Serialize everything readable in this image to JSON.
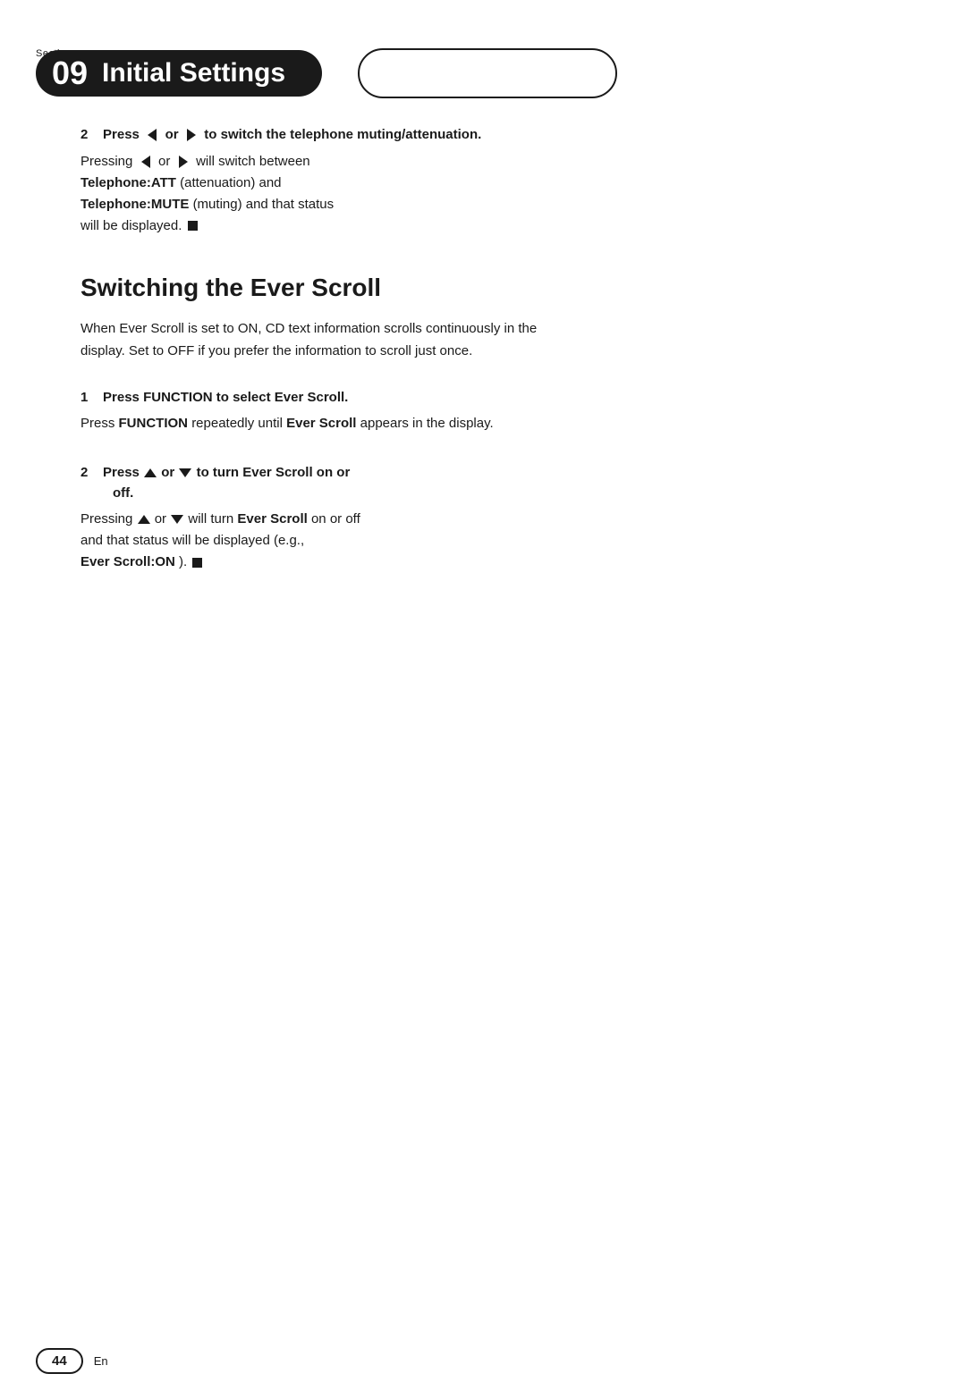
{
  "page": {
    "section_label": "Section",
    "section_number": "09",
    "section_title": "Initial Settings",
    "page_number": "44",
    "language": "En"
  },
  "step2_telephone": {
    "heading": "2   Press ◄ or ► to switch the telephone muting/attenuation.",
    "heading_plain": "Press",
    "heading_or": "or",
    "heading_suffix": "to switch the telephone muting/attenuation.",
    "body_line1": "Pressing",
    "body_or": "or",
    "body_line2": "will switch between",
    "telephone_att_label": "Telephone:ATT",
    "telephone_att_suffix": "(attenuation) and",
    "telephone_mute_label": "Telephone:MUTE",
    "telephone_mute_suffix": "(muting) and that status will be displayed."
  },
  "switching_ever_scroll": {
    "heading": "Switching the Ever Scroll",
    "intro": "When Ever Scroll is set to ON, CD text information scrolls continuously in the display. Set to OFF if you prefer the information to scroll just once.",
    "step1": {
      "heading": "1   Press FUNCTION to select Ever Scroll.",
      "body_prefix": "Press",
      "function_label": "FUNCTION",
      "body_middle": "repeatedly until",
      "ever_scroll_label": "Ever Scroll",
      "body_suffix": "appears in the display."
    },
    "step2": {
      "heading": "2   Press ▲ or ▼ to turn Ever Scroll on or off.",
      "heading_prefix": "Press",
      "heading_or": "or",
      "heading_suffix": "to turn Ever Scroll on or off.",
      "body_prefix": "Pressing",
      "body_or": "or",
      "body_middle": "will turn",
      "ever_scroll_bold": "Ever Scroll",
      "body_suffix": "on or off and that status will be displayed (e.g.,",
      "ever_scroll_on_label": "Ever Scroll:ON",
      "body_end": ")."
    }
  }
}
